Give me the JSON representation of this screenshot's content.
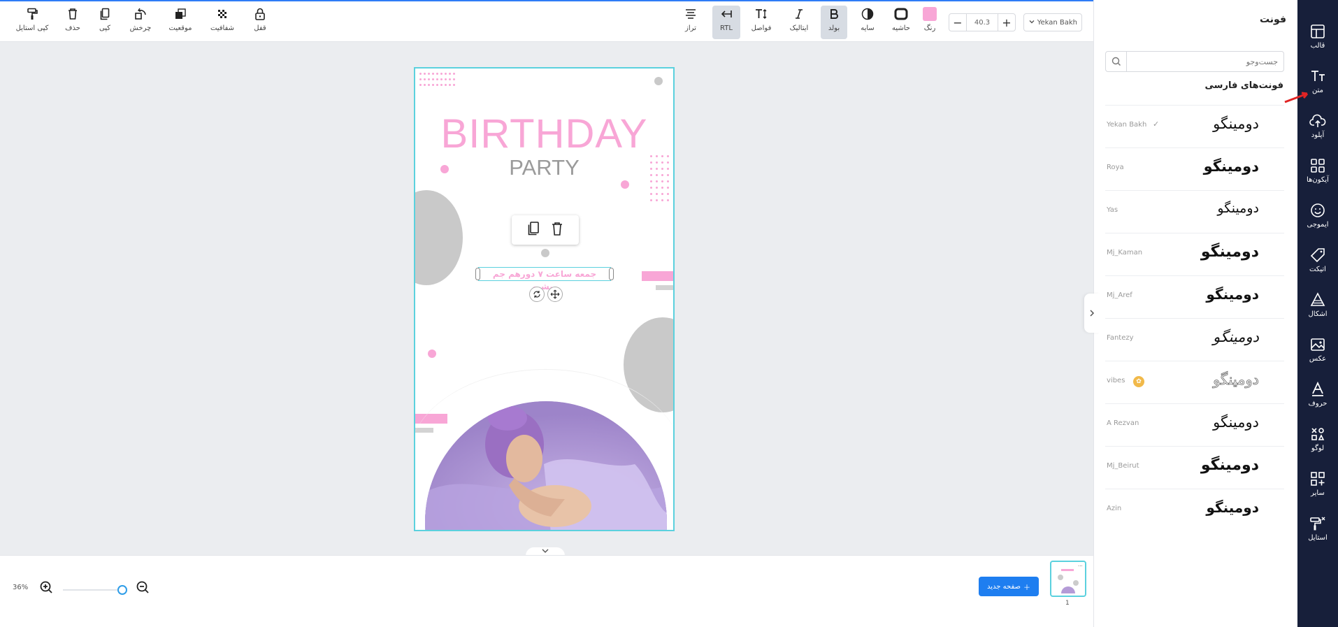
{
  "toolbar": {
    "tools_left": [
      {
        "id": "copy-style",
        "label": "کپی استایل",
        "icon": "paint-roller-icon"
      },
      {
        "id": "delete",
        "label": "حذف",
        "icon": "trash-icon"
      },
      {
        "id": "copy",
        "label": "کپی",
        "icon": "copy-icon"
      },
      {
        "id": "rotate",
        "label": "چرخش",
        "icon": "rotate-icon"
      },
      {
        "id": "position",
        "label": "موقعیت",
        "icon": "layers-icon"
      },
      {
        "id": "opacity",
        "label": "شفافیت",
        "icon": "checkerboard-icon"
      },
      {
        "id": "lock",
        "label": "قفل",
        "icon": "lock-icon"
      }
    ],
    "align_label": "تراز",
    "rtl_label": "RTL",
    "spacing_label": "فواصل",
    "italic_label": "ایتالیک",
    "bold_label": "بولد",
    "shadow_label": "سایه",
    "border_label": "حاشیه",
    "color_label": "رنگ",
    "text_color": "#f8a6d6",
    "font_size": "40.3",
    "minus": "−",
    "plus": "+",
    "font_family": "Yekan Bakh"
  },
  "canvas": {
    "title": "BIRTHDAY",
    "subtitle": "PARTY",
    "selected_text": "جمعه ساعت ۷ دورهم جم میشیم",
    "accent_color": "#f8a6d6",
    "selection_color": "#5bd1de"
  },
  "bottom": {
    "zoom_level": "36%",
    "zoom_fraction": 0.36,
    "new_page_label": "صفحه جدید",
    "page_number": "1"
  },
  "font_panel": {
    "title": "فونت",
    "search_placeholder": "جست‌وجو",
    "section_label": "فونت‌های فارسی",
    "sample_text": "دومینگو",
    "fonts": [
      {
        "name": "Yekan Bakh",
        "selected": true
      },
      {
        "name": "Roya"
      },
      {
        "name": "Yas"
      },
      {
        "name": "Mj_Kaman"
      },
      {
        "name": "Mj_Aref"
      },
      {
        "name": "Fantezy"
      },
      {
        "name": "vibes",
        "premium": true
      },
      {
        "name": "A Rezvan"
      },
      {
        "name": "Mj_Beirut"
      },
      {
        "name": "Azin"
      }
    ]
  },
  "sidebar": {
    "items": [
      {
        "label": "قالب",
        "icon": "template-icon"
      },
      {
        "label": "متن",
        "icon": "text-icon",
        "active": true
      },
      {
        "label": "آپلود",
        "icon": "upload-icon"
      },
      {
        "label": "آیکون‌ها",
        "icon": "grid-icon"
      },
      {
        "label": "ایموجی",
        "icon": "emoji-icon"
      },
      {
        "label": "اتیکت",
        "icon": "tag-icon"
      },
      {
        "label": "اشکال",
        "icon": "shapes-icon"
      },
      {
        "label": "عکس",
        "icon": "image-icon"
      },
      {
        "label": "حروف",
        "icon": "letter-a-icon"
      },
      {
        "label": "لوگو",
        "icon": "logo-icon"
      },
      {
        "label": "سایر",
        "icon": "plus-grid-icon"
      },
      {
        "label": "استایل",
        "icon": "style-icon"
      }
    ]
  }
}
